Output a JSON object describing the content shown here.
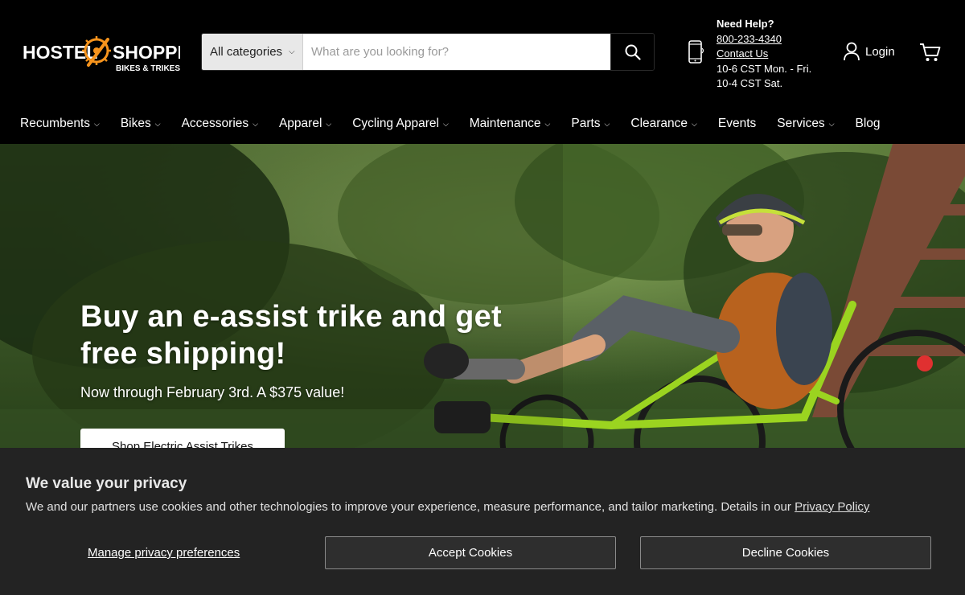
{
  "brand": {
    "name_left": "HOSTEL",
    "name_right": "SHOPPE",
    "tagline": "BIKES & TRIKES",
    "accent_color": "#f7941d"
  },
  "search": {
    "category_label": "All categories",
    "placeholder": "What are you looking for?",
    "value": ""
  },
  "help": {
    "heading": "Need Help?",
    "phone": "800-233-4340",
    "contact_label": "Contact Us",
    "hours_weekday": "10-6 CST Mon. - Fri.",
    "hours_saturday": "10-4 CST Sat."
  },
  "account": {
    "login_label": "Login"
  },
  "nav": {
    "items": [
      {
        "label": "Recumbents",
        "dropdown": true
      },
      {
        "label": "Bikes",
        "dropdown": true
      },
      {
        "label": "Accessories",
        "dropdown": true
      },
      {
        "label": "Apparel",
        "dropdown": true
      },
      {
        "label": "Cycling Apparel",
        "dropdown": true
      },
      {
        "label": "Maintenance",
        "dropdown": true
      },
      {
        "label": "Parts",
        "dropdown": true
      },
      {
        "label": "Clearance",
        "dropdown": true
      },
      {
        "label": "Events",
        "dropdown": false
      },
      {
        "label": "Services",
        "dropdown": true
      },
      {
        "label": "Blog",
        "dropdown": false
      }
    ]
  },
  "hero": {
    "title": "Buy an e-assist trike and get free shipping!",
    "subtitle": "Now through February 3rd. A $375 value!",
    "cta_label": "Shop Electric Assist Trikes"
  },
  "cookie": {
    "title": "We value your privacy",
    "text": "We and our partners use cookies and other technologies to improve your experience, measure performance, and tailor marketing. Details in our",
    "policy_link": "Privacy Policy",
    "manage_label": "Manage privacy preferences",
    "accept_label": "Accept Cookies",
    "decline_label": "Decline Cookies"
  }
}
